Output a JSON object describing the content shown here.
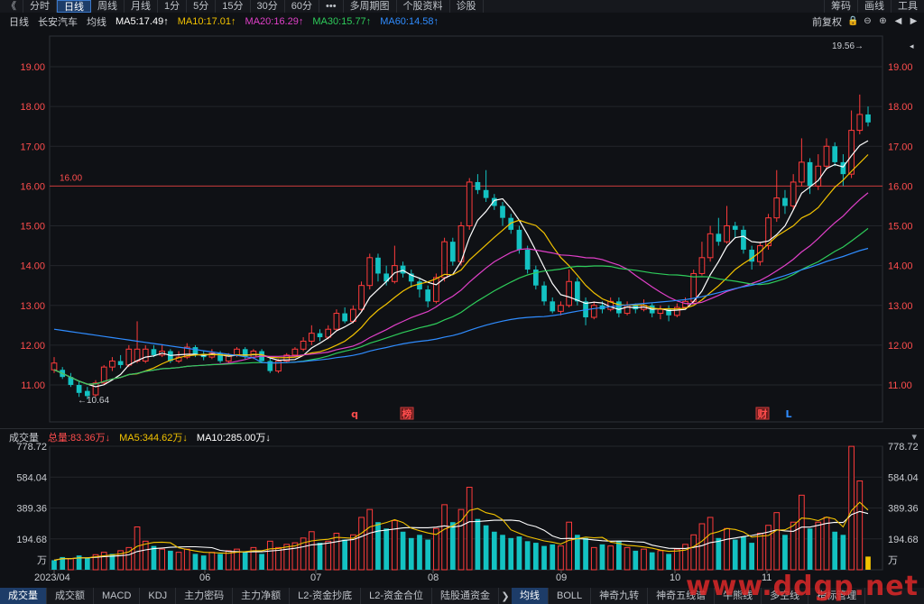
{
  "toolbar": {
    "left": [
      "《",
      "分时",
      "日线",
      "周线",
      "月线",
      "1分",
      "5分",
      "15分",
      "30分",
      "60分",
      "•••",
      "多周期图",
      "个股资料",
      "诊股"
    ],
    "active": "日线",
    "right": [
      "筹码",
      "画线",
      "工具"
    ]
  },
  "mabar": {
    "period": "日线",
    "stock": "长安汽车",
    "avg": "均线",
    "ma5": "MA5:17.49↑",
    "ma10": "MA10:17.01↑",
    "ma20": "MA20:16.29↑",
    "ma30": "MA30:15.77↑",
    "ma60": "MA60:14.58↑",
    "adjust": "前复权"
  },
  "colors": {
    "ma5": "#ffffff",
    "ma10": "#f2c200",
    "ma20": "#e040c8",
    "ma30": "#2ecc5a",
    "ma60": "#2f8cff",
    "up": "#ff3b3b",
    "down": "#13c2c2",
    "axis": "#ff4d4d"
  },
  "volbar": {
    "label": "成交量",
    "total": "总量:83.36万↓",
    "ma5": "MA5:344.62万↓",
    "ma10": "MA10:285.00万↓"
  },
  "annotations": {
    "high": "19.56→",
    "low": "←10.64",
    "hline": "16.00",
    "marks": [
      "q",
      "榜",
      "财",
      "L"
    ]
  },
  "price_axis": [
    "19.00",
    "18.00",
    "17.00",
    "16.00",
    "15.00",
    "14.00",
    "13.00",
    "12.00",
    "11.00"
  ],
  "volume_axis": [
    "778.72",
    "584.04",
    "389.36",
    "194.68",
    "万"
  ],
  "date_axis": [
    "2023/04",
    "06",
    "07",
    "08",
    "09",
    "10",
    "11"
  ],
  "bottombar": {
    "left": [
      "成交量",
      "成交额",
      "MACD",
      "KDJ",
      "主力密码",
      "主力净额",
      "L2-资金抄底",
      "L2-资金合位",
      "陆股通资金"
    ],
    "right": [
      "均线",
      "BOLL",
      "神奇九转",
      "神奇五线谱",
      "牛熊线",
      "多空线",
      "指标管理"
    ]
  },
  "chart_data": {
    "type": "candlestick",
    "ylim": [
      10.5,
      19.5
    ],
    "volume_ylim": [
      0,
      778.72
    ],
    "hline": 16.0,
    "candles": [
      [
        11.55,
        11.38,
        11.7,
        11.3,
        1
      ],
      [
        11.38,
        11.2,
        11.45,
        11.15,
        0
      ],
      [
        11.2,
        11.0,
        11.3,
        10.95,
        0
      ],
      [
        11.0,
        10.8,
        11.1,
        10.7,
        0
      ],
      [
        10.85,
        10.72,
        10.95,
        10.64,
        0
      ],
      [
        10.75,
        11.05,
        11.12,
        10.7,
        1
      ],
      [
        11.05,
        11.45,
        11.5,
        11.0,
        1
      ],
      [
        11.45,
        11.6,
        11.7,
        11.35,
        1
      ],
      [
        11.6,
        11.5,
        11.75,
        11.42,
        0
      ],
      [
        11.5,
        11.9,
        12.0,
        11.45,
        1
      ],
      [
        11.9,
        11.6,
        12.6,
        11.55,
        1
      ],
      [
        11.6,
        11.9,
        12.0,
        11.55,
        1
      ],
      [
        11.9,
        11.75,
        12.0,
        11.7,
        0
      ],
      [
        11.75,
        11.85,
        12.0,
        11.7,
        1
      ],
      [
        11.85,
        11.6,
        11.9,
        11.55,
        0
      ],
      [
        11.6,
        11.7,
        11.85,
        11.55,
        1
      ],
      [
        11.7,
        11.95,
        12.05,
        11.65,
        1
      ],
      [
        11.95,
        11.75,
        12.0,
        11.7,
        0
      ],
      [
        11.75,
        11.7,
        11.85,
        11.62,
        0
      ],
      [
        11.7,
        11.8,
        11.9,
        11.65,
        1
      ],
      [
        11.8,
        11.6,
        11.85,
        11.55,
        0
      ],
      [
        11.6,
        11.75,
        11.8,
        11.55,
        1
      ],
      [
        11.75,
        11.9,
        11.95,
        11.7,
        1
      ],
      [
        11.9,
        11.7,
        11.95,
        11.65,
        0
      ],
      [
        11.7,
        11.85,
        11.9,
        11.65,
        1
      ],
      [
        11.85,
        11.6,
        11.9,
        11.55,
        0
      ],
      [
        11.6,
        11.35,
        11.7,
        11.3,
        0
      ],
      [
        11.35,
        11.6,
        11.65,
        11.3,
        1
      ],
      [
        11.6,
        11.75,
        11.8,
        11.55,
        1
      ],
      [
        11.75,
        11.9,
        11.95,
        11.7,
        1
      ],
      [
        11.9,
        12.1,
        12.2,
        11.85,
        1
      ],
      [
        12.1,
        12.3,
        12.5,
        12.0,
        1
      ],
      [
        12.3,
        12.2,
        12.4,
        12.1,
        0
      ],
      [
        12.2,
        12.4,
        12.5,
        12.15,
        1
      ],
      [
        12.4,
        12.8,
        12.9,
        12.35,
        1
      ],
      [
        12.8,
        12.6,
        12.95,
        12.55,
        0
      ],
      [
        12.6,
        12.9,
        13.0,
        12.55,
        1
      ],
      [
        12.9,
        13.5,
        13.6,
        12.85,
        1
      ],
      [
        13.5,
        14.2,
        14.3,
        13.4,
        1
      ],
      [
        14.2,
        13.8,
        14.3,
        13.6,
        0
      ],
      [
        13.8,
        13.6,
        14.0,
        13.5,
        0
      ],
      [
        13.6,
        14.0,
        14.5,
        13.55,
        1
      ],
      [
        14.0,
        13.8,
        14.1,
        13.7,
        0
      ],
      [
        13.8,
        13.6,
        13.9,
        13.45,
        0
      ],
      [
        13.6,
        13.4,
        13.7,
        13.2,
        0
      ],
      [
        13.4,
        13.1,
        13.5,
        12.95,
        0
      ],
      [
        13.1,
        13.7,
        13.8,
        13.05,
        1
      ],
      [
        13.7,
        14.6,
        14.7,
        13.6,
        1
      ],
      [
        14.6,
        14.1,
        14.7,
        14.0,
        0
      ],
      [
        14.1,
        15.0,
        15.1,
        14.0,
        1
      ],
      [
        15.0,
        16.1,
        16.2,
        14.9,
        1
      ],
      [
        16.1,
        15.9,
        16.3,
        15.8,
        0
      ],
      [
        15.9,
        15.7,
        16.4,
        15.6,
        0
      ],
      [
        15.7,
        15.5,
        15.8,
        15.4,
        0
      ],
      [
        15.5,
        15.2,
        15.6,
        15.0,
        0
      ],
      [
        15.2,
        14.9,
        15.3,
        14.8,
        0
      ],
      [
        14.9,
        14.4,
        15.0,
        14.3,
        0
      ],
      [
        14.4,
        13.9,
        14.5,
        13.8,
        0
      ],
      [
        13.9,
        13.5,
        14.0,
        13.4,
        0
      ],
      [
        13.5,
        13.1,
        13.6,
        13.0,
        0
      ],
      [
        13.1,
        12.85,
        13.2,
        12.8,
        0
      ],
      [
        12.85,
        13.0,
        13.1,
        12.75,
        1
      ],
      [
        13.0,
        13.6,
        13.9,
        12.95,
        1
      ],
      [
        13.6,
        13.1,
        13.7,
        13.0,
        0
      ],
      [
        13.1,
        12.7,
        13.2,
        12.5,
        0
      ],
      [
        12.7,
        13.0,
        13.1,
        12.65,
        1
      ],
      [
        13.0,
        12.9,
        13.1,
        12.8,
        0
      ],
      [
        12.9,
        13.1,
        13.2,
        12.85,
        1
      ],
      [
        13.1,
        12.8,
        13.2,
        12.7,
        0
      ],
      [
        12.8,
        13.0,
        13.1,
        12.75,
        1
      ],
      [
        13.0,
        12.9,
        13.05,
        12.8,
        0
      ],
      [
        12.9,
        13.0,
        13.15,
        12.85,
        1
      ],
      [
        13.0,
        12.8,
        13.05,
        12.7,
        0
      ],
      [
        12.8,
        12.9,
        13.0,
        12.65,
        1
      ],
      [
        12.9,
        12.75,
        13.0,
        12.6,
        0
      ],
      [
        12.75,
        12.95,
        13.05,
        12.7,
        1
      ],
      [
        12.95,
        13.1,
        13.2,
        12.9,
        1
      ],
      [
        13.1,
        13.8,
        13.9,
        13.05,
        1
      ],
      [
        13.8,
        14.2,
        14.6,
        13.75,
        1
      ],
      [
        14.2,
        14.8,
        15.0,
        14.1,
        1
      ],
      [
        14.8,
        14.6,
        15.2,
        14.5,
        0
      ],
      [
        14.6,
        15.0,
        15.5,
        14.55,
        1
      ],
      [
        15.0,
        14.9,
        15.1,
        14.7,
        0
      ],
      [
        14.9,
        14.4,
        15.0,
        14.3,
        0
      ],
      [
        14.4,
        14.1,
        14.5,
        13.9,
        0
      ],
      [
        14.1,
        14.5,
        14.6,
        14.0,
        1
      ],
      [
        14.5,
        15.2,
        15.3,
        14.4,
        1
      ],
      [
        15.2,
        15.7,
        16.4,
        15.1,
        1
      ],
      [
        15.7,
        15.5,
        15.9,
        15.3,
        0
      ],
      [
        15.5,
        16.1,
        16.3,
        15.4,
        1
      ],
      [
        16.1,
        16.6,
        17.2,
        16.0,
        1
      ],
      [
        16.6,
        16.0,
        16.7,
        15.8,
        0
      ],
      [
        16.0,
        16.5,
        16.8,
        15.9,
        1
      ],
      [
        16.5,
        17.0,
        17.2,
        16.4,
        1
      ],
      [
        17.0,
        16.6,
        17.1,
        16.5,
        0
      ],
      [
        16.6,
        16.3,
        16.8,
        16.0,
        0
      ],
      [
        16.3,
        17.4,
        17.9,
        16.2,
        1
      ],
      [
        17.4,
        17.8,
        18.3,
        17.3,
        1
      ],
      [
        17.8,
        17.6,
        18.0,
        17.5,
        0
      ]
    ],
    "volumes": [
      [
        60,
        0
      ],
      [
        80,
        0
      ],
      [
        70,
        1
      ],
      [
        90,
        0
      ],
      [
        75,
        0
      ],
      [
        95,
        1
      ],
      [
        110,
        1
      ],
      [
        100,
        0
      ],
      [
        120,
        1
      ],
      [
        140,
        1
      ],
      [
        270,
        1
      ],
      [
        180,
        1
      ],
      [
        150,
        0
      ],
      [
        130,
        1
      ],
      [
        120,
        0
      ],
      [
        110,
        1
      ],
      [
        130,
        1
      ],
      [
        100,
        0
      ],
      [
        90,
        0
      ],
      [
        110,
        1
      ],
      [
        100,
        0
      ],
      [
        120,
        1
      ],
      [
        130,
        1
      ],
      [
        110,
        0
      ],
      [
        140,
        1
      ],
      [
        100,
        0
      ],
      [
        180,
        1
      ],
      [
        140,
        1
      ],
      [
        160,
        1
      ],
      [
        170,
        1
      ],
      [
        200,
        1
      ],
      [
        240,
        1
      ],
      [
        170,
        0
      ],
      [
        180,
        1
      ],
      [
        230,
        1
      ],
      [
        190,
        0
      ],
      [
        220,
        1
      ],
      [
        330,
        1
      ],
      [
        380,
        1
      ],
      [
        300,
        0
      ],
      [
        260,
        0
      ],
      [
        310,
        1
      ],
      [
        240,
        0
      ],
      [
        200,
        0
      ],
      [
        220,
        0
      ],
      [
        190,
        0
      ],
      [
        260,
        1
      ],
      [
        410,
        1
      ],
      [
        300,
        0
      ],
      [
        380,
        1
      ],
      [
        520,
        1
      ],
      [
        320,
        0
      ],
      [
        280,
        0
      ],
      [
        240,
        0
      ],
      [
        220,
        0
      ],
      [
        200,
        0
      ],
      [
        210,
        0
      ],
      [
        180,
        0
      ],
      [
        170,
        0
      ],
      [
        150,
        0
      ],
      [
        160,
        0
      ],
      [
        150,
        1
      ],
      [
        300,
        1
      ],
      [
        220,
        0
      ],
      [
        200,
        0
      ],
      [
        140,
        1
      ],
      [
        160,
        0
      ],
      [
        150,
        1
      ],
      [
        180,
        0
      ],
      [
        140,
        1
      ],
      [
        120,
        0
      ],
      [
        130,
        1
      ],
      [
        110,
        0
      ],
      [
        120,
        1
      ],
      [
        100,
        0
      ],
      [
        130,
        1
      ],
      [
        160,
        1
      ],
      [
        220,
        1
      ],
      [
        290,
        1
      ],
      [
        330,
        1
      ],
      [
        200,
        0
      ],
      [
        260,
        1
      ],
      [
        190,
        0
      ],
      [
        210,
        0
      ],
      [
        170,
        0
      ],
      [
        230,
        1
      ],
      [
        280,
        1
      ],
      [
        360,
        1
      ],
      [
        220,
        0
      ],
      [
        300,
        1
      ],
      [
        470,
        1
      ],
      [
        260,
        0
      ],
      [
        300,
        1
      ],
      [
        330,
        1
      ],
      [
        240,
        0
      ],
      [
        220,
        0
      ],
      [
        778,
        1
      ],
      [
        560,
        1
      ],
      [
        83,
        2
      ]
    ]
  }
}
